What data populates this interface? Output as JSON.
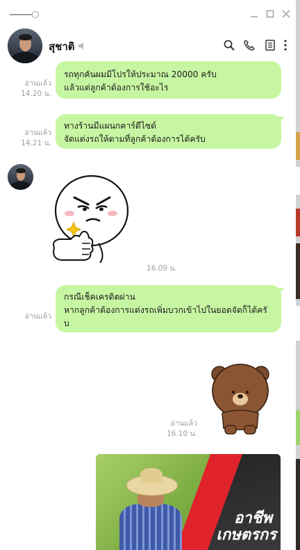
{
  "header": {
    "contact_name": "สุชาติ"
  },
  "messages": [
    {
      "lines": [
        "รถทุกคันผมมีโปรให้ประมาณ 20000 ครับ",
        "แล้วแต่ลูกค้าต้องการใช้อะไร"
      ],
      "read_label": "อ่านแล้ว",
      "time": "14.20 น."
    },
    {
      "lines": [
        "ทางร้านมีแผนกคาร์ดีไซด์",
        "จัดแต่งรถให้ตามที่ลูกค้าต้องการได้ครับ"
      ],
      "read_label": "อ่านแล้ว",
      "time": "14.21 น."
    },
    {
      "lines": [
        "กรณีเช็คเครดิตผ่าน",
        "หากลูกค้าต้องการแต่งรถเพิ่มบวกเข้าไปในยอดจัดก็ได้ครั",
        "บ"
      ],
      "read_label": "อ่านแล้ว"
    }
  ],
  "incoming": {
    "sticker_time": "16.09 น."
  },
  "outgoing_sticker": {
    "read_label": "อ่านแล้ว",
    "time": "16.10 น."
  },
  "image_message": {
    "text_line1": "อาชีพ",
    "text_line2": "เกษตรกร"
  },
  "colors": {
    "bubble": "#c7f6a3",
    "meta_text": "#9a9fa4"
  },
  "icons": [
    "window-slider-icon",
    "minimize-icon",
    "maximize-icon",
    "close-icon",
    "mute-icon",
    "search-icon",
    "phone-icon",
    "notes-icon",
    "more-icon"
  ]
}
